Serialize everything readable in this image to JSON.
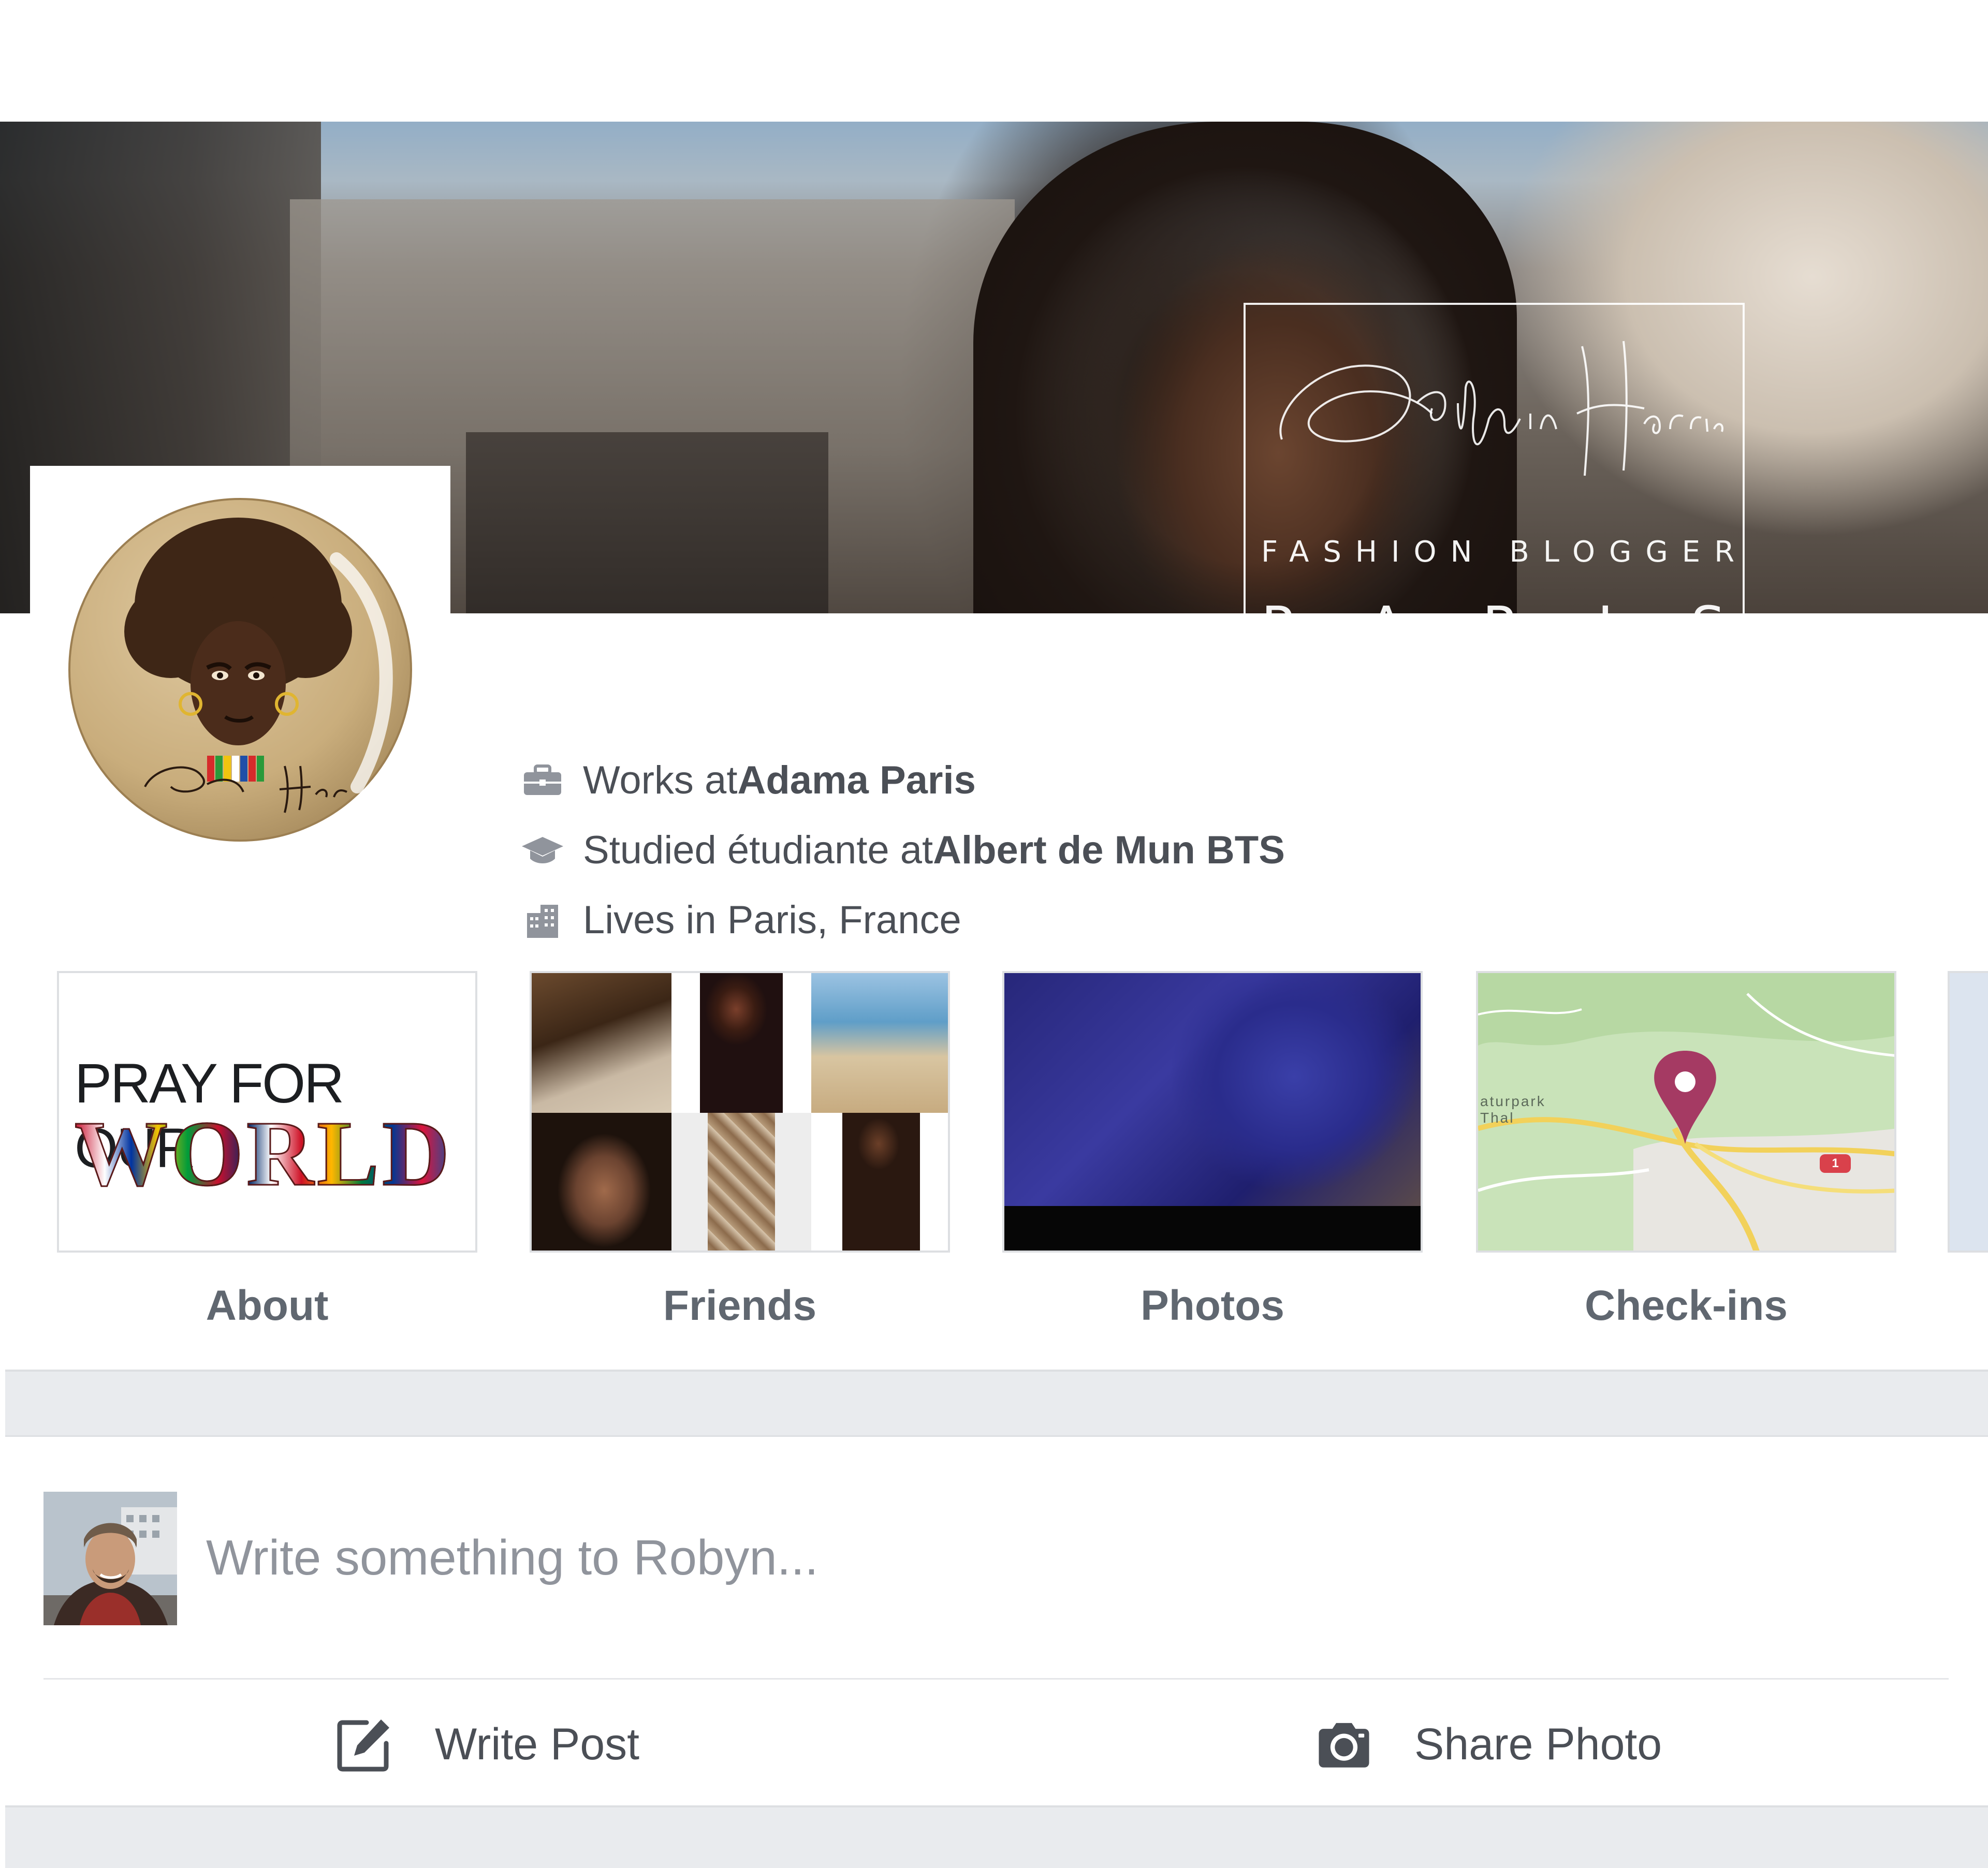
{
  "cover": {
    "brand_subtitle": "FASHION BLOGGER",
    "brand_city": "PARIS",
    "signature_text": "Robyn Harris"
  },
  "profile": {
    "avatar_signature": "Robyn Harris"
  },
  "intro": {
    "work_prefix": "Works at ",
    "work_place": "Adama Paris",
    "study_prefix": "Studied étudiante at ",
    "study_place": "Albert de Mun BTS",
    "lives": "Lives in Paris, France"
  },
  "tiles": [
    {
      "label": "About",
      "thumb_line1": "PRAY FOR OUR",
      "thumb_line2": "WORLD"
    },
    {
      "label": "Friends"
    },
    {
      "label": "Photos"
    },
    {
      "label": "Check-ins",
      "map_label": "aturpark\nThal",
      "route_badge": "1"
    }
  ],
  "composer": {
    "placeholder": "Write something to Robyn...",
    "write_post": "Write Post",
    "share_photo": "Share Photo"
  },
  "icons": {
    "work": "briefcase-icon",
    "study": "graduation-cap-icon",
    "lives": "city-buildings-icon",
    "write": "edit-pencil-icon",
    "photo": "camera-icon",
    "map": "map-pin-icon"
  },
  "colors": {
    "text_primary": "#4b4f56",
    "text_muted": "#90949c",
    "label_gray": "#606770",
    "icon_gray": "#90949c",
    "band_gray": "#e9ebee",
    "map_pin": "#a53a63"
  }
}
